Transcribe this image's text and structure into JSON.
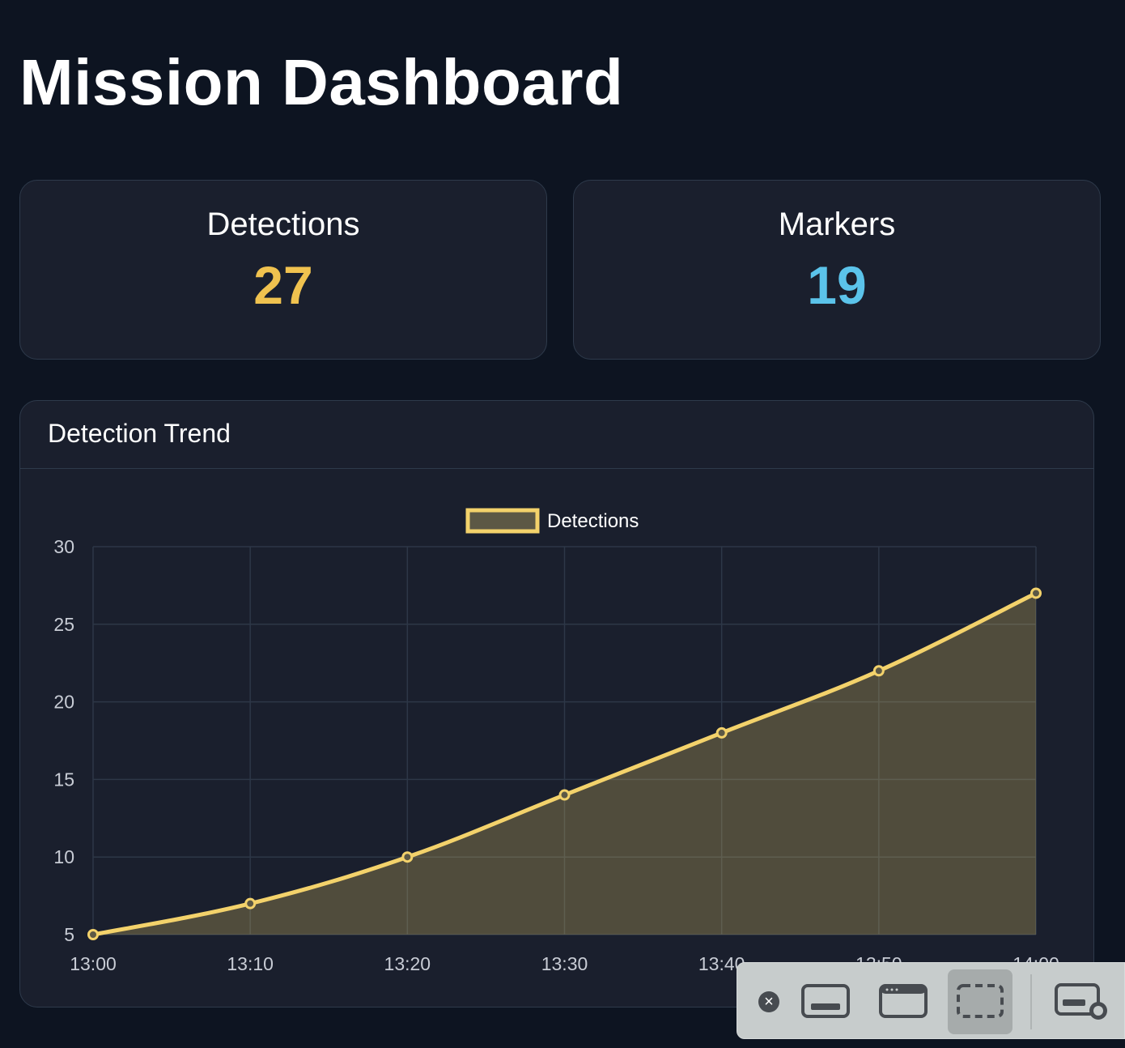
{
  "page": {
    "title": "Mission Dashboard"
  },
  "stats": [
    {
      "label": "Detections",
      "value": "27",
      "color": "#f0c24f"
    },
    {
      "label": "Markers",
      "value": "19",
      "color": "#5bc3ea"
    }
  ],
  "chart": {
    "title": "Detection Trend"
  },
  "chart_data": {
    "type": "line",
    "categories": [
      "13:00",
      "13:10",
      "13:20",
      "13:30",
      "13:40",
      "13:50",
      "14:00"
    ],
    "series": [
      {
        "name": "Detections",
        "values": [
          5,
          7,
          10,
          14,
          18,
          22,
          27
        ],
        "color": "#f3d26b",
        "fill": "rgba(243,210,107,0.25)"
      }
    ],
    "ylim": [
      5,
      30
    ],
    "yticks": [
      5,
      10,
      15,
      20,
      25,
      30
    ],
    "xlabel": "",
    "ylabel": "",
    "grid": true,
    "legend": "top-center"
  },
  "toolbar": {
    "items": [
      {
        "icon": "close-icon"
      },
      {
        "icon": "capture-entire-screen-icon"
      },
      {
        "icon": "capture-window-icon"
      },
      {
        "icon": "capture-selection-icon"
      },
      {
        "icon": "record-screen-icon"
      }
    ]
  }
}
